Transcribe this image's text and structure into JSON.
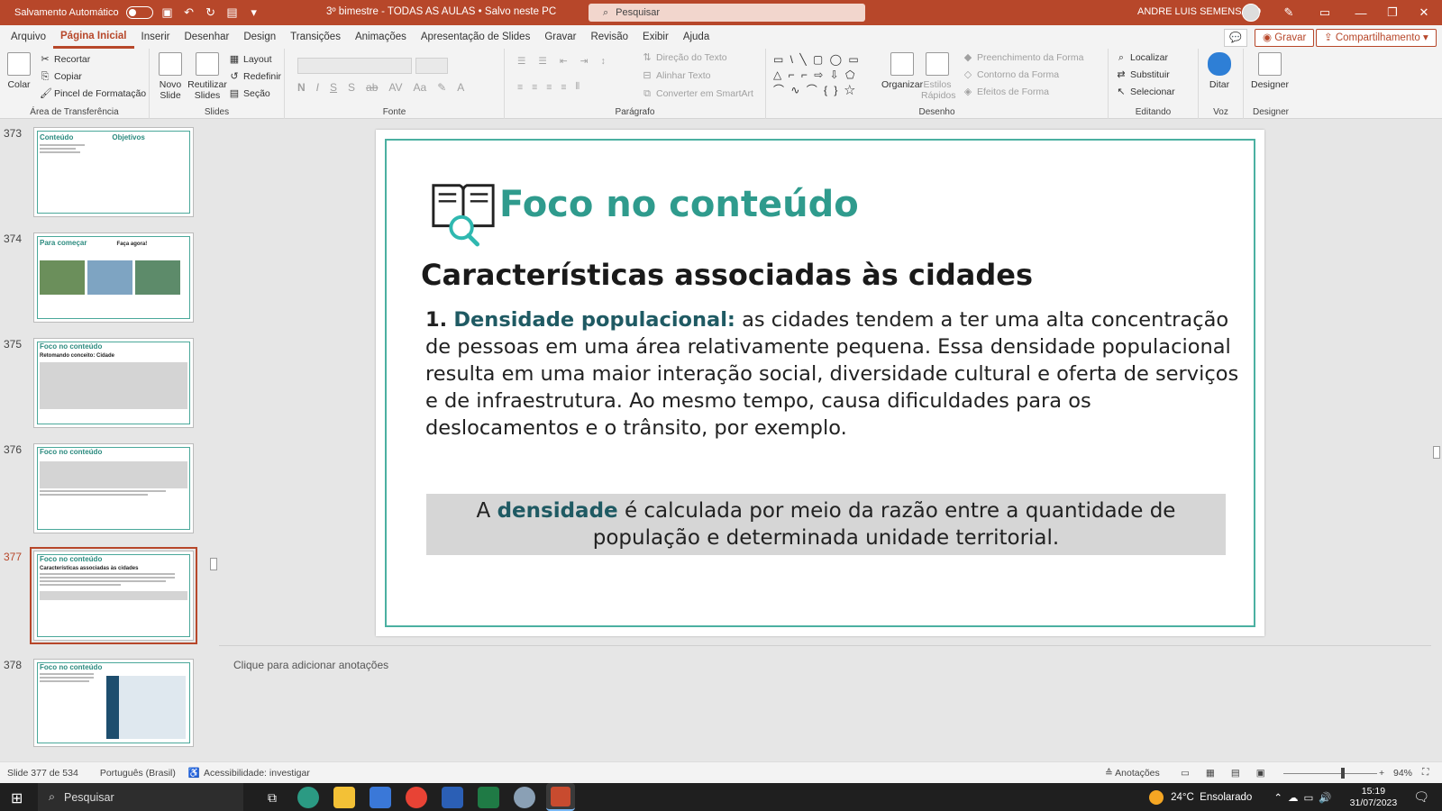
{
  "titlebar": {
    "autosave_label": "Salvamento Automático",
    "doc_title": "3º bimestre - TODAS AS AULAS • Salvo neste PC",
    "search_placeholder": "Pesquisar",
    "user": "ANDRE LUIS SEMENSATO"
  },
  "menu": {
    "items": [
      "Arquivo",
      "Página Inicial",
      "Inserir",
      "Desenhar",
      "Design",
      "Transições",
      "Animações",
      "Apresentação de Slides",
      "Gravar",
      "Revisão",
      "Exibir",
      "Ajuda"
    ],
    "active": "Página Inicial",
    "gravar": "Gravar",
    "share": "Compartilhamento"
  },
  "ribbon": {
    "clipboard": {
      "paste": "Colar",
      "cut": "Recortar",
      "copy": "Copiar",
      "format_painter": "Pincel de Formatação",
      "label": "Área de Transferência"
    },
    "slides": {
      "new_slide": "Novo Slide",
      "reuse": "Reutilizar Slides",
      "layout": "Layout",
      "reset": "Redefinir",
      "section": "Seção",
      "label": "Slides"
    },
    "font": {
      "label": "Fonte"
    },
    "paragraph": {
      "text_direction": "Direção do Texto",
      "align_text": "Alinhar Texto",
      "smartart": "Converter em SmartArt",
      "label": "Parágrafo"
    },
    "drawing": {
      "arrange": "Organizar",
      "quick_styles": "Estilos Rápidos",
      "fill": "Preenchimento da Forma",
      "outline": "Contorno da Forma",
      "effects": "Efeitos de Forma",
      "label": "Desenho"
    },
    "editing": {
      "find": "Localizar",
      "replace": "Substituir",
      "select": "Selecionar",
      "label": "Editando"
    },
    "voice": {
      "dictate": "Ditar",
      "label": "Voz"
    },
    "designer": {
      "btn": "Designer",
      "label": "Designer"
    }
  },
  "thumbnails": [
    {
      "num": "373",
      "title": "Conteúdo",
      "title2": "Objetivos",
      "selected": false
    },
    {
      "num": "374",
      "title": "Para começar",
      "title2": "Faça agora!",
      "selected": false
    },
    {
      "num": "375",
      "title": "Foco no conteúdo",
      "sub": "Retomando conceito: Cidade",
      "selected": false
    },
    {
      "num": "376",
      "title": "Foco no conteúdo",
      "selected": false
    },
    {
      "num": "377",
      "title": "Foco no conteúdo",
      "sub": "Características associadas às cidades",
      "selected": true
    },
    {
      "num": "378",
      "title": "Foco no conteúdo",
      "selected": false
    }
  ],
  "slide": {
    "title": "Foco no conteúdo",
    "subtitle": "Características associadas às cidades",
    "item_number": "1.",
    "item_term": "Densidade populacional:",
    "item_text": " as cidades tendem a ter uma alta concentração de pessoas em uma área relativamente pequena. Essa densidade populacional resulta em uma maior interação social, diversidade cultural e oferta de serviços e de infraestrutura. Ao mesmo tempo, causa dificuldades para os deslocamentos e o trânsito, por exemplo.",
    "box_pre": "A ",
    "box_term": "densidade",
    "box_post": " é calculada por meio da razão entre a quantidade de população e determinada unidade territorial."
  },
  "notes_placeholder": "Clique para adicionar anotações",
  "status": {
    "slide_count": "Slide 377 de 534",
    "language": "Português (Brasil)",
    "accessibility": "Acessibilidade: investigar",
    "notes": "Anotações",
    "zoom": "94%"
  },
  "taskbar": {
    "search": "Pesquisar",
    "weather": "24°C  Ensolarado",
    "time": "15:19",
    "date": "31/07/2023"
  },
  "colors": {
    "accent": "#b7472a",
    "teal": "#2f9b8d",
    "term": "#1f5a63"
  }
}
